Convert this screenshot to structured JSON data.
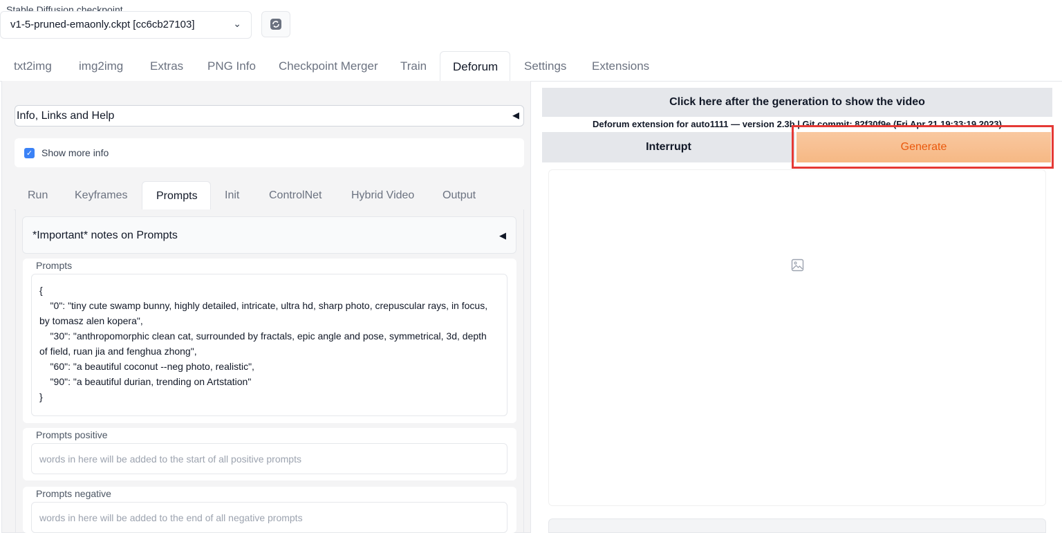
{
  "checkpoint": {
    "label": "Stable Diffusion checkpoint",
    "value": "v1-5-pruned-emaonly.ckpt [cc6cb27103]"
  },
  "main_tabs": [
    {
      "label": "txt2img"
    },
    {
      "label": "img2img"
    },
    {
      "label": "Extras"
    },
    {
      "label": "PNG Info"
    },
    {
      "label": "Checkpoint Merger"
    },
    {
      "label": "Train"
    },
    {
      "label": "Deforum",
      "active": true
    },
    {
      "label": "Settings"
    },
    {
      "label": "Extensions"
    }
  ],
  "left": {
    "info_accordion": "Info, Links and Help",
    "show_more_info": {
      "label": "Show more info",
      "checked": true
    },
    "sub_tabs": [
      {
        "label": "Run"
      },
      {
        "label": "Keyframes"
      },
      {
        "label": "Prompts",
        "active": true
      },
      {
        "label": "Init"
      },
      {
        "label": "ControlNet"
      },
      {
        "label": "Hybrid Video"
      },
      {
        "label": "Output"
      }
    ],
    "notes_accordion": "*Important* notes on Prompts",
    "prompts": {
      "label": "Prompts",
      "lines": [
        "{",
        "    \"0\": \"tiny cute swamp bunny, highly detailed, intricate, ultra hd, sharp photo, crepuscular rays, in focus,",
        "by tomasz alen kopera\",",
        "    \"30\": \"anthropomorphic clean cat, surrounded by fractals, epic angle and pose, symmetrical, 3d, depth",
        "of field, ruan jia and fenghua zhong\",",
        "    \"60\": \"a beautiful coconut --neg photo, realistic\",",
        "    \"90\": \"a beautiful durian, trending on Artstation\"",
        "}"
      ]
    },
    "prompts_positive": {
      "label": "Prompts positive",
      "placeholder": "words in here will be added to the start of all positive prompts"
    },
    "prompts_negative": {
      "label": "Prompts negative",
      "placeholder": "words in here will be added to the end of all negative prompts"
    }
  },
  "right": {
    "show_video_button": "Click here after the generation to show the video",
    "version_text": "Deforum extension for auto1111 — version 2.3b | Git commit: 82f30f9e (Fri Apr 21 19:33:19 2023)",
    "interrupt_button": "Interrupt",
    "generate_button": "Generate",
    "gallery_icon": "image-icon"
  },
  "colors": {
    "accent_checkbox": "#3b82f6",
    "generate_text": "#ea580c",
    "highlight_border": "#e53935"
  }
}
